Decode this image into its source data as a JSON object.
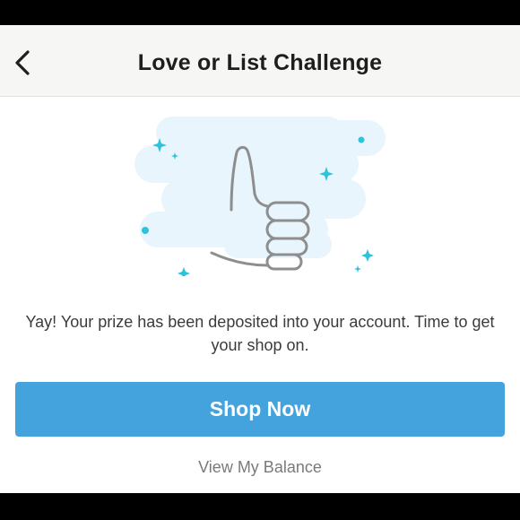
{
  "header": {
    "title": "Love or List Challenge",
    "back_icon": "chevron-left-icon"
  },
  "illustration": {
    "icon": "thumbs-up-icon",
    "sparkle_color": "#2cc3dc",
    "cloud_color": "#e8f5fc",
    "line_color": "#8e8e8e"
  },
  "message": {
    "text": "Yay! Your prize has been deposited into your account. Time to get your shop on."
  },
  "actions": {
    "primary_label": "Shop Now",
    "primary_color": "#44a3dd",
    "secondary_label": "View My Balance"
  }
}
